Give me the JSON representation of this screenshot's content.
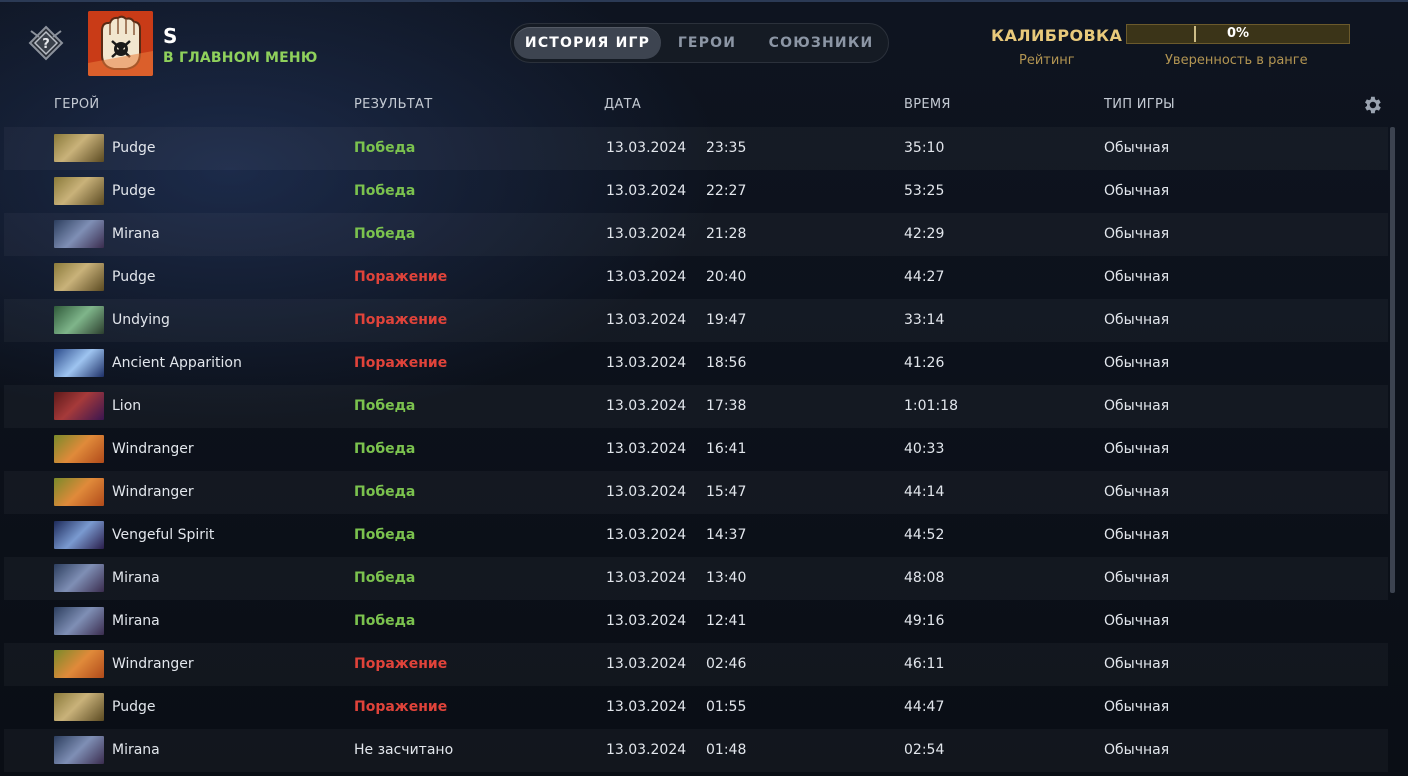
{
  "colors": {
    "win": "#7bc24e",
    "loss": "#e0433a",
    "accent_gold": "#e8c97b",
    "status_green": "#8fd15c"
  },
  "profile": {
    "name": "S",
    "status": "В ГЛАВНОМ МЕНЮ",
    "rank_icon": "unknown-rank-icon",
    "avatar_icon": "fist-jolly-roger-avatar"
  },
  "tabs": [
    {
      "label": "ИСТОРИЯ ИГР",
      "active": true
    },
    {
      "label": "ГЕРОИ",
      "active": false
    },
    {
      "label": "СОЮЗНИКИ",
      "active": false
    }
  ],
  "calibration": {
    "title": "КАЛИБРОВКА",
    "rating_label": "Рейтинг",
    "confidence_value": "0%",
    "confidence_label": "Уверенность в ранге"
  },
  "columns": {
    "hero": "ГЕРОЙ",
    "result": "РЕЗУЛЬТАТ",
    "date": "ДАТА",
    "duration": "ВРЕМЯ",
    "game_type": "ТИП ИГРЫ"
  },
  "settings_icon": "gear-icon",
  "matches": [
    {
      "hero": "Pudge",
      "result": "Победа",
      "outcome": "win",
      "date": "13.03.2024",
      "time": "23:35",
      "duration": "35:10",
      "type": "Обычная"
    },
    {
      "hero": "Pudge",
      "result": "Победа",
      "outcome": "win",
      "date": "13.03.2024",
      "time": "22:27",
      "duration": "53:25",
      "type": "Обычная"
    },
    {
      "hero": "Mirana",
      "result": "Победа",
      "outcome": "win",
      "date": "13.03.2024",
      "time": "21:28",
      "duration": "42:29",
      "type": "Обычная"
    },
    {
      "hero": "Pudge",
      "result": "Поражение",
      "outcome": "loss",
      "date": "13.03.2024",
      "time": "20:40",
      "duration": "44:27",
      "type": "Обычная"
    },
    {
      "hero": "Undying",
      "result": "Поражение",
      "outcome": "loss",
      "date": "13.03.2024",
      "time": "19:47",
      "duration": "33:14",
      "type": "Обычная"
    },
    {
      "hero": "Ancient Apparition",
      "result": "Поражение",
      "outcome": "loss",
      "date": "13.03.2024",
      "time": "18:56",
      "duration": "41:26",
      "type": "Обычная"
    },
    {
      "hero": "Lion",
      "result": "Победа",
      "outcome": "win",
      "date": "13.03.2024",
      "time": "17:38",
      "duration": "1:01:18",
      "type": "Обычная"
    },
    {
      "hero": "Windranger",
      "result": "Победа",
      "outcome": "win",
      "date": "13.03.2024",
      "time": "16:41",
      "duration": "40:33",
      "type": "Обычная"
    },
    {
      "hero": "Windranger",
      "result": "Победа",
      "outcome": "win",
      "date": "13.03.2024",
      "time": "15:47",
      "duration": "44:14",
      "type": "Обычная"
    },
    {
      "hero": "Vengeful Spirit",
      "result": "Победа",
      "outcome": "win",
      "date": "13.03.2024",
      "time": "14:37",
      "duration": "44:52",
      "type": "Обычная"
    },
    {
      "hero": "Mirana",
      "result": "Победа",
      "outcome": "win",
      "date": "13.03.2024",
      "time": "13:40",
      "duration": "48:08",
      "type": "Обычная"
    },
    {
      "hero": "Mirana",
      "result": "Победа",
      "outcome": "win",
      "date": "13.03.2024",
      "time": "12:41",
      "duration": "49:16",
      "type": "Обычная"
    },
    {
      "hero": "Windranger",
      "result": "Поражение",
      "outcome": "loss",
      "date": "13.03.2024",
      "time": "02:46",
      "duration": "46:11",
      "type": "Обычная"
    },
    {
      "hero": "Pudge",
      "result": "Поражение",
      "outcome": "loss",
      "date": "13.03.2024",
      "time": "01:55",
      "duration": "44:47",
      "type": "Обычная"
    },
    {
      "hero": "Mirana",
      "result": "Не засчитано",
      "outcome": "none",
      "date": "13.03.2024",
      "time": "01:48",
      "duration": "02:54",
      "type": "Обычная"
    }
  ]
}
